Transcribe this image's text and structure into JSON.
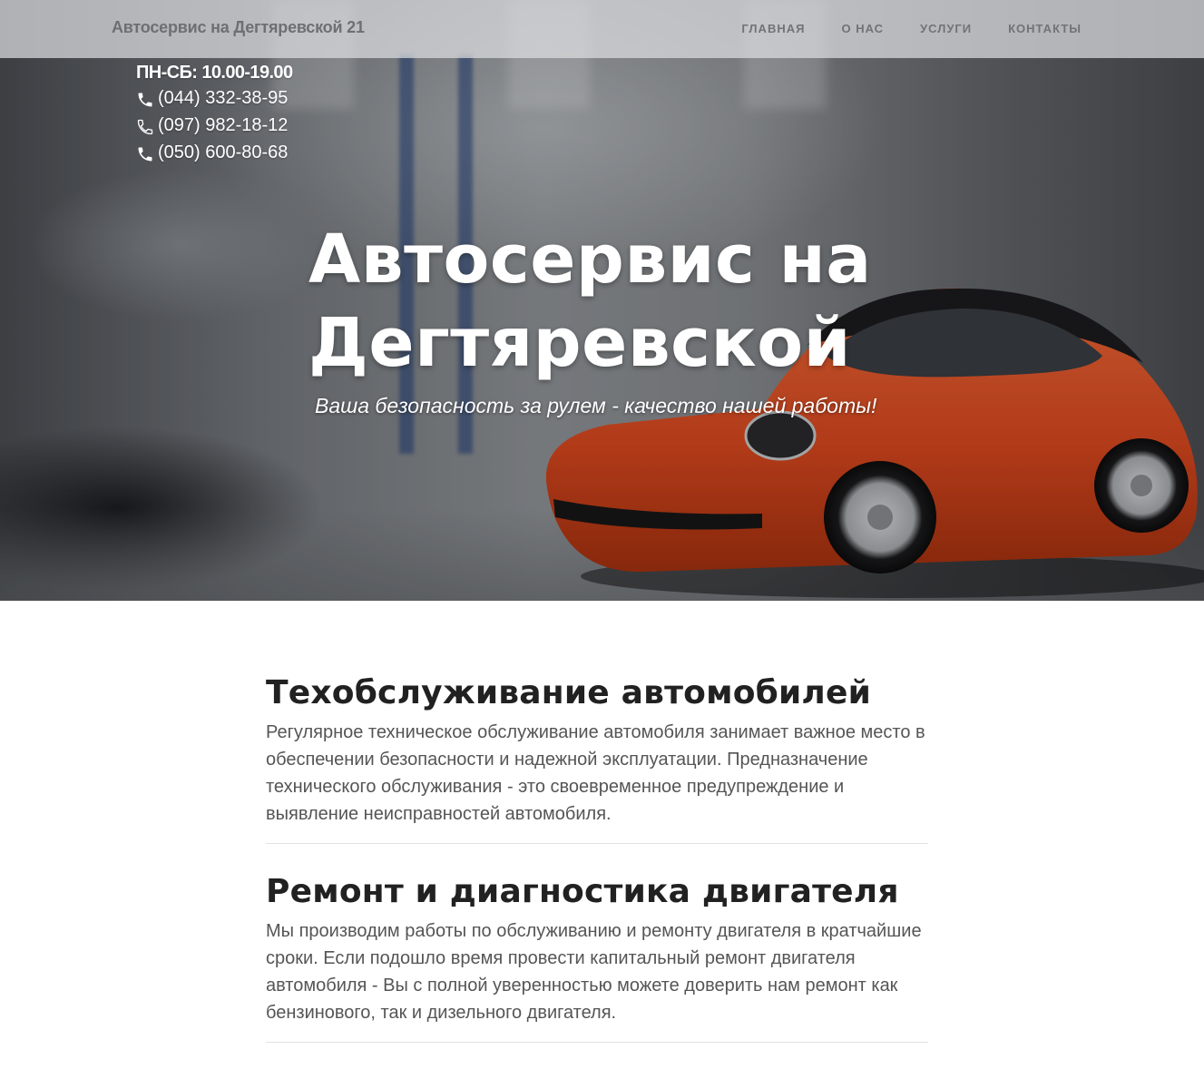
{
  "navbar": {
    "brand": "Автосервис на Дегтяревской 21",
    "items": [
      {
        "label": "Главная"
      },
      {
        "label": "О нас"
      },
      {
        "label": "Услуги"
      },
      {
        "label": "Контакты"
      }
    ]
  },
  "contacts": {
    "hours": "ПН-СБ: 10.00-19.00",
    "phones": [
      {
        "number": "(044) 332-38-95",
        "icon": "phone-solid-icon"
      },
      {
        "number": "(097) 982-18-12",
        "icon": "phone-outline-icon"
      },
      {
        "number": "(050) 600-80-68",
        "icon": "phone-solid-icon"
      }
    ]
  },
  "hero": {
    "title_line1": "Автосервис на",
    "title_line2": "Дегтяревской",
    "subtitle": "Ваша безопасность за рулем - качество нашей работы!",
    "image": "orange-beetle-car-in-garage"
  },
  "services": [
    {
      "title": "Техобслуживание автомобилей",
      "text": "Регулярное техническое обслуживание автомобиля занимает важное место в обеспечении безопасности и надежной эксплуатации. Предназначение технического обслуживания - это своевременное предупреждение и выявление неисправностей автомобиля."
    },
    {
      "title": "Ремонт и диагностика двигателя",
      "text": "Мы производим работы по обслуживанию и ремонту двигателя в кратчайшие сроки. Если подошло время провести капитальный ремонт двигателя автомобиля - Вы с полной уверенностью можете доверить нам ремонт как бензинового, так и дизельного двигателя."
    }
  ],
  "colors": {
    "car_body": "#d9481f",
    "title_text": "#212121",
    "body_text": "#555555",
    "nav_text": "#707377"
  }
}
